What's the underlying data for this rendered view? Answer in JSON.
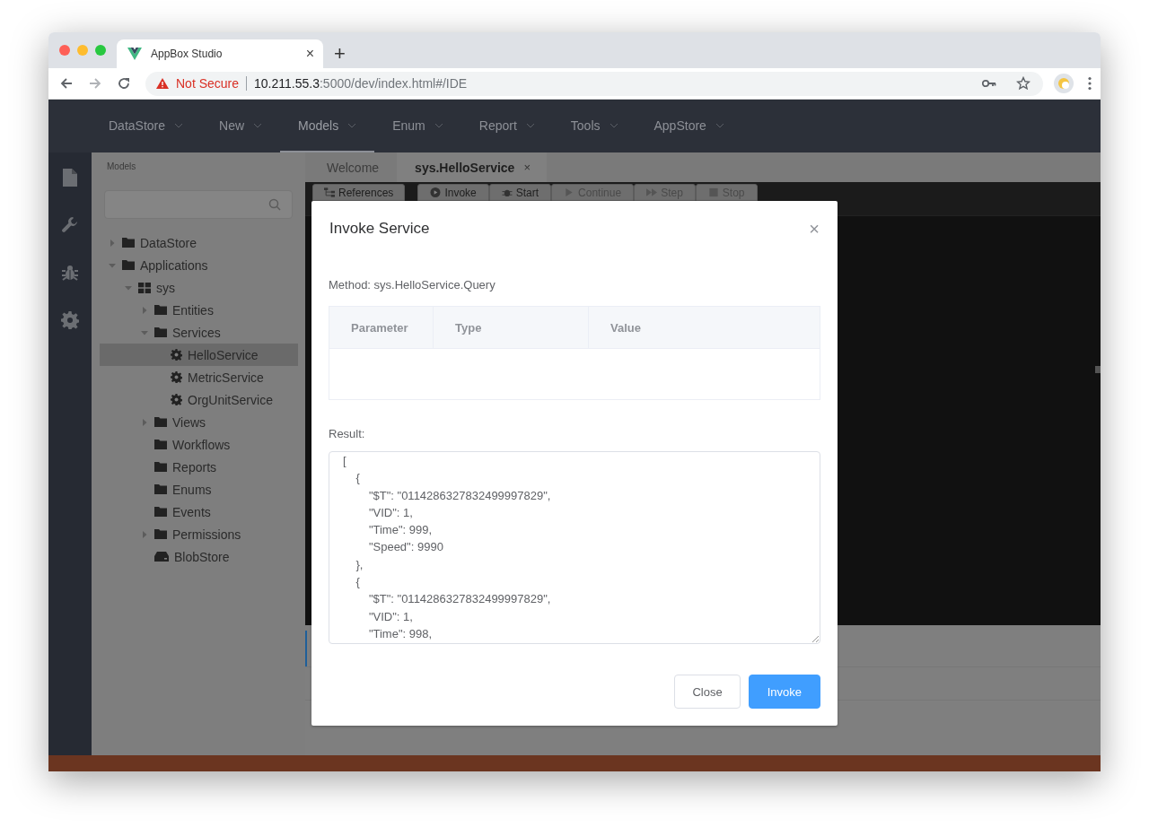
{
  "browser": {
    "tab_title": "AppBox Studio",
    "tab_close": "×",
    "new_tab": "+",
    "security": "Not Secure",
    "url_host": "10.211.55.3",
    "url_path": ":5000/dev/index.html#/IDE"
  },
  "nav": [
    {
      "label": "DataStore",
      "selected": false
    },
    {
      "label": "New",
      "selected": false
    },
    {
      "label": "Models",
      "selected": true
    },
    {
      "label": "Enum",
      "selected": false
    },
    {
      "label": "Report",
      "selected": false
    },
    {
      "label": "Tools",
      "selected": false
    },
    {
      "label": "AppStore",
      "selected": false
    }
  ],
  "rail": [
    {
      "kind": "file"
    },
    {
      "kind": "wrench"
    },
    {
      "kind": "bug"
    },
    {
      "kind": "gear"
    }
  ],
  "sidebar": {
    "title": "Models",
    "tree": [
      {
        "label": "DataStore",
        "kind": "folder",
        "expanded": false,
        "selected": false
      },
      {
        "label": "Applications",
        "kind": "folder",
        "expanded": true,
        "selected": false,
        "children": [
          {
            "label": "sys",
            "kind": "app",
            "expanded": true,
            "selected": false,
            "children": [
              {
                "label": "Entities",
                "kind": "folder",
                "expanded": false,
                "selected": false
              },
              {
                "label": "Services",
                "kind": "folder",
                "expanded": true,
                "selected": false,
                "children": [
                  {
                    "label": "HelloService",
                    "kind": "service",
                    "selected": true
                  },
                  {
                    "label": "MetricService",
                    "kind": "service",
                    "selected": false
                  },
                  {
                    "label": "OrgUnitService",
                    "kind": "service",
                    "selected": false
                  }
                ]
              },
              {
                "label": "Views",
                "kind": "folder",
                "expanded": false,
                "selected": false
              },
              {
                "label": "Workflows",
                "kind": "folder",
                "selected": false
              },
              {
                "label": "Reports",
                "kind": "folder",
                "selected": false
              },
              {
                "label": "Enums",
                "kind": "folder",
                "selected": false
              },
              {
                "label": "Events",
                "kind": "folder",
                "selected": false
              },
              {
                "label": "Permissions",
                "kind": "folder",
                "expanded": false,
                "selected": false
              },
              {
                "label": "BlobStore",
                "kind": "store",
                "selected": false
              }
            ]
          }
        ]
      }
    ]
  },
  "editor_tabs": [
    {
      "label": "Welcome",
      "selected": false
    },
    {
      "label": "sys.HelloService",
      "selected": true,
      "close": "×"
    }
  ],
  "toolbar": [
    {
      "label": "References",
      "kind": "references",
      "disabled": false
    },
    {
      "label": "Invoke",
      "kind": "invoke",
      "disabled": false
    },
    {
      "label": "Start",
      "kind": "start",
      "disabled": false
    },
    {
      "label": "Continue",
      "kind": "continue",
      "disabled": true
    },
    {
      "label": "Step",
      "kind": "step",
      "disabled": true
    },
    {
      "label": "Stop",
      "kind": "stop",
      "disabled": true
    }
  ],
  "dialog": {
    "title": "Invoke Service",
    "close": "×",
    "method": "Method: sys.HelloService.Query",
    "columns": [
      "Parameter",
      "Type",
      "Value"
    ],
    "result_label": "Result:",
    "result": "[\n    {\n        \"$T\": \"0114286327832499997829\",\n        \"VID\": 1,\n        \"Time\": 999,\n        \"Speed\": 9990\n    },\n    {\n        \"$T\": \"0114286327832499997829\",\n        \"VID\": 1,\n        \"Time\": 998,",
    "buttons": [
      {
        "label": "Close",
        "kind": "default"
      },
      {
        "label": "Invoke",
        "kind": "primary"
      }
    ]
  }
}
